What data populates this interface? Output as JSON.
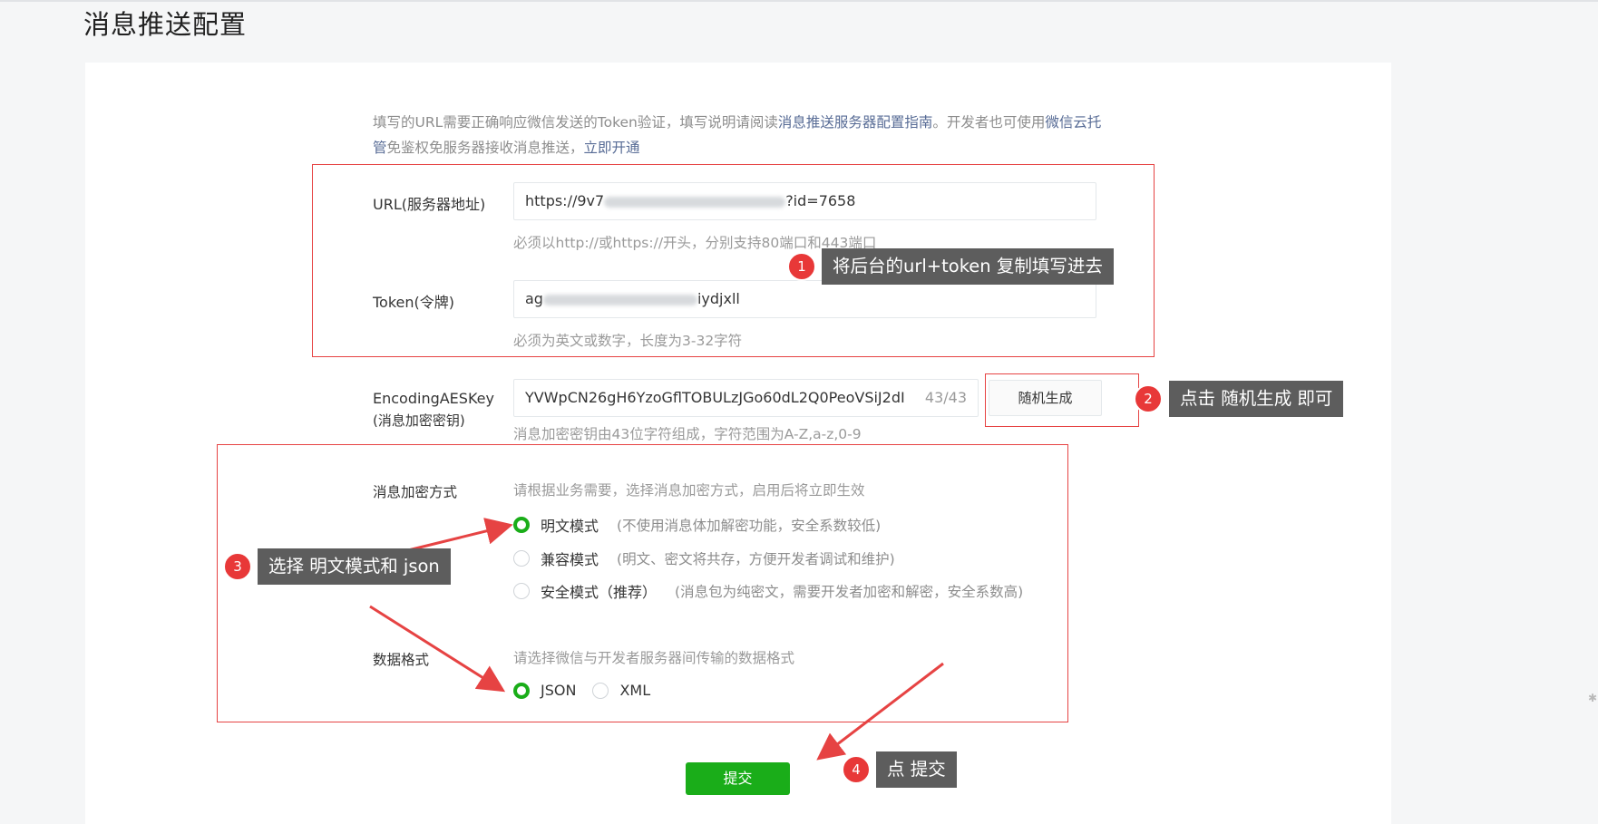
{
  "page": {
    "title": "消息推送配置"
  },
  "intro": {
    "text1": "填写的URL需要正确响应微信发送的Token验证，填写说明请阅读",
    "link1": "消息推送服务器配置指南",
    "text2": "。开发者也可使用",
    "link2": "微信云托管",
    "text3": "免鉴权免服务器接收消息推送，",
    "link3": "立即开通"
  },
  "url": {
    "label": "URL(服务器地址)",
    "value_prefix": "https://9v7",
    "value_suffix": "?id=7658",
    "hint": "必须以http://或https://开头，分别支持80端口和443端口"
  },
  "token": {
    "label": "Token(令牌)",
    "value_prefix": "ag",
    "value_suffix": "iydjxll",
    "hint": "必须为英文或数字，长度为3-32字符"
  },
  "aes": {
    "label_line1": "EncodingAESKey",
    "label_line2": "(消息加密密钥)",
    "value": "YVWpCN26gH6YzoGflTOBULzJGo60dL2Q0PeoVSiJ2dI",
    "counter": "43/43",
    "generate_button": "随机生成",
    "hint": "消息加密密钥由43位字符组成，字符范围为A-Z,a-z,0-9"
  },
  "encryption": {
    "label": "消息加密方式",
    "hint": "请根据业务需要，选择消息加密方式，启用后将立即生效",
    "options": [
      {
        "label": "明文模式",
        "desc": "(不使用消息体加解密功能，安全系数较低)",
        "selected": true
      },
      {
        "label": "兼容模式",
        "desc": "(明文、密文将共存，方便开发者调试和维护)",
        "selected": false
      },
      {
        "label": "安全模式（推荐）",
        "desc": "(消息包为纯密文，需要开发者加密和解密，安全系数高)",
        "selected": false
      }
    ]
  },
  "format": {
    "label": "数据格式",
    "hint": "请选择微信与开发者服务器间传输的数据格式",
    "options": [
      {
        "label": "JSON",
        "selected": true
      },
      {
        "label": "XML",
        "selected": false
      }
    ]
  },
  "submit_label": "提交",
  "annotations": [
    {
      "number": "1",
      "text": "将后台的url+token 复制填写进去"
    },
    {
      "number": "2",
      "text": "点击 随机生成 即可"
    },
    {
      "number": "3",
      "text": "选择 明文模式和 json"
    },
    {
      "number": "4",
      "text": "点 提交"
    }
  ],
  "colors": {
    "accent_green": "#1aad19",
    "link_blue": "#576b95",
    "annotation_red": "#e64343",
    "callout_gray": "#5d5d5d"
  }
}
